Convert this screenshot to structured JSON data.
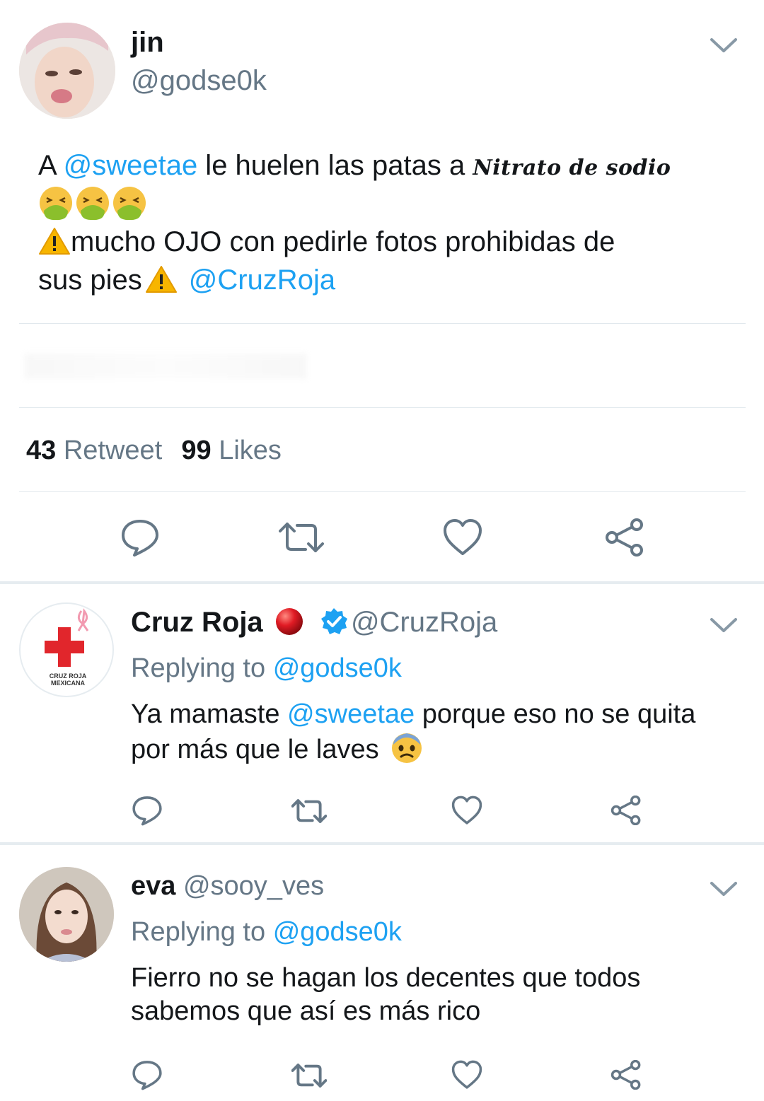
{
  "tweet": {
    "name": "jin",
    "handle": "@godse0k",
    "text_a": "A ",
    "mention_1": "@sweetae",
    "text_b": " le huelen las patas a ",
    "script_text": "Nitrato de sodio",
    "text_c": "mucho OJO con pedirle fotos prohibidas de",
    "text_d": "sus pies",
    "mention_2": "@CruzRoja",
    "emojis_line": [
      "nauseated-face-emoji",
      "nauseated-face-emoji",
      "nauseated-face-emoji"
    ],
    "stats": {
      "retweets_count": "43",
      "retweets_label": "Retweet",
      "likes_count": "99",
      "likes_label": "Likes"
    }
  },
  "replies": [
    {
      "name": "Cruz Roja",
      "handle": "@CruzRoja",
      "avatar_text": "CRUZ ROJA MEXICANA",
      "replying_label": "Replying to",
      "replying_to": "@godse0k",
      "text_a": "Ya mamaste ",
      "mention": "@sweetae",
      "text_b": " porque eso no se quita",
      "text_c": "por más que le laves"
    },
    {
      "name": "eva",
      "handle": "@sooy_ves",
      "replying_label": "Replying to",
      "replying_to": "@godse0k",
      "text_a": "Fierro no se hagan los decentes que todos",
      "text_b": "sabemos que así es más rico"
    }
  ],
  "colors": {
    "link": "#1da1f2",
    "muted": "#657786",
    "icon": "#657786",
    "verified": "#1da1f2",
    "divider": "#e1e8ed"
  }
}
